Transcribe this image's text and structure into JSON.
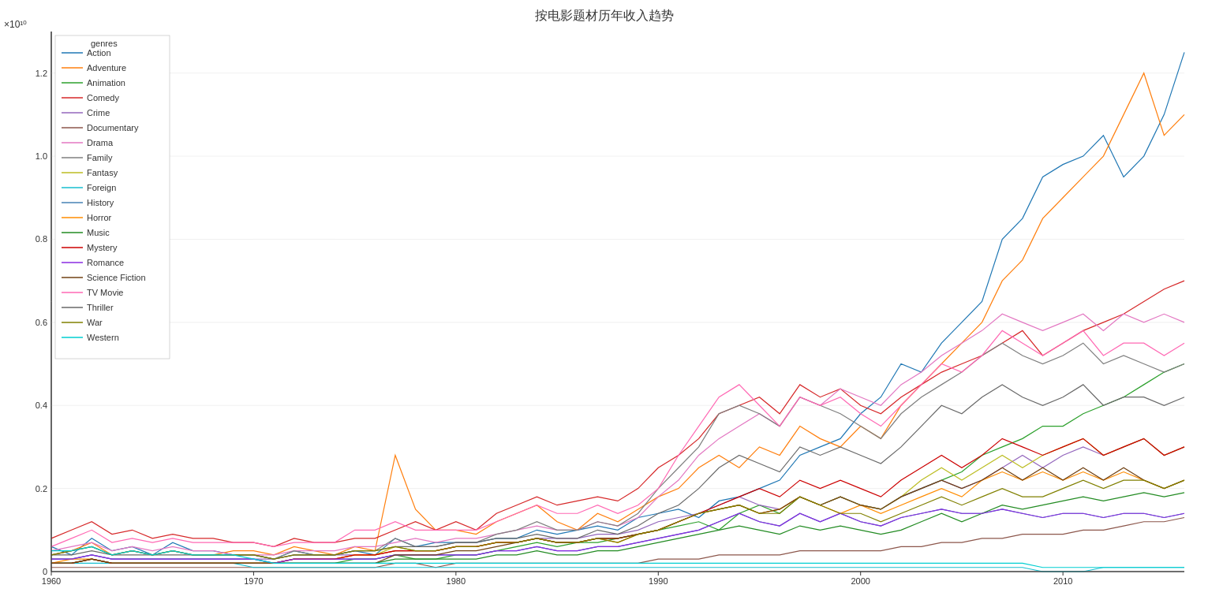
{
  "chart": {
    "title": "按电影题材历年收入趋势",
    "x_label": "",
    "y_label": "",
    "x_scale_note": "×10¹⁰",
    "y_ticks": [
      0,
      0.2,
      0.4,
      0.6,
      0.8,
      1.0,
      1.2
    ],
    "x_ticks": [
      1960,
      1970,
      1980,
      1990,
      2000,
      2010
    ],
    "genres": [
      {
        "name": "Action",
        "color": "#1f77b4"
      },
      {
        "name": "Adventure",
        "color": "#ff7f0e"
      },
      {
        "name": "Animation",
        "color": "#2ca02c"
      },
      {
        "name": "Comedy",
        "color": "#d62728"
      },
      {
        "name": "Crime",
        "color": "#9467bd"
      },
      {
        "name": "Documentary",
        "color": "#8c564b"
      },
      {
        "name": "Drama",
        "color": "#e377c2"
      },
      {
        "name": "Family",
        "color": "#7f7f7f"
      },
      {
        "name": "Fantasy",
        "color": "#bcbd22"
      },
      {
        "name": "Foreign",
        "color": "#17becf"
      },
      {
        "name": "History",
        "color": "#1f77b4"
      },
      {
        "name": "Horror",
        "color": "#ff7f0e"
      },
      {
        "name": "Music",
        "color": "#2ca02c"
      },
      {
        "name": "Mystery",
        "color": "#d62728"
      },
      {
        "name": "Romance",
        "color": "#9467bd"
      },
      {
        "name": "Science Fiction",
        "color": "#8c564b"
      },
      {
        "name": "TV Movie",
        "color": "#e377c2"
      },
      {
        "name": "Thriller",
        "color": "#7f7f7f"
      },
      {
        "name": "War",
        "color": "#bcbd22"
      },
      {
        "name": "Western",
        "color": "#17becf"
      }
    ]
  }
}
